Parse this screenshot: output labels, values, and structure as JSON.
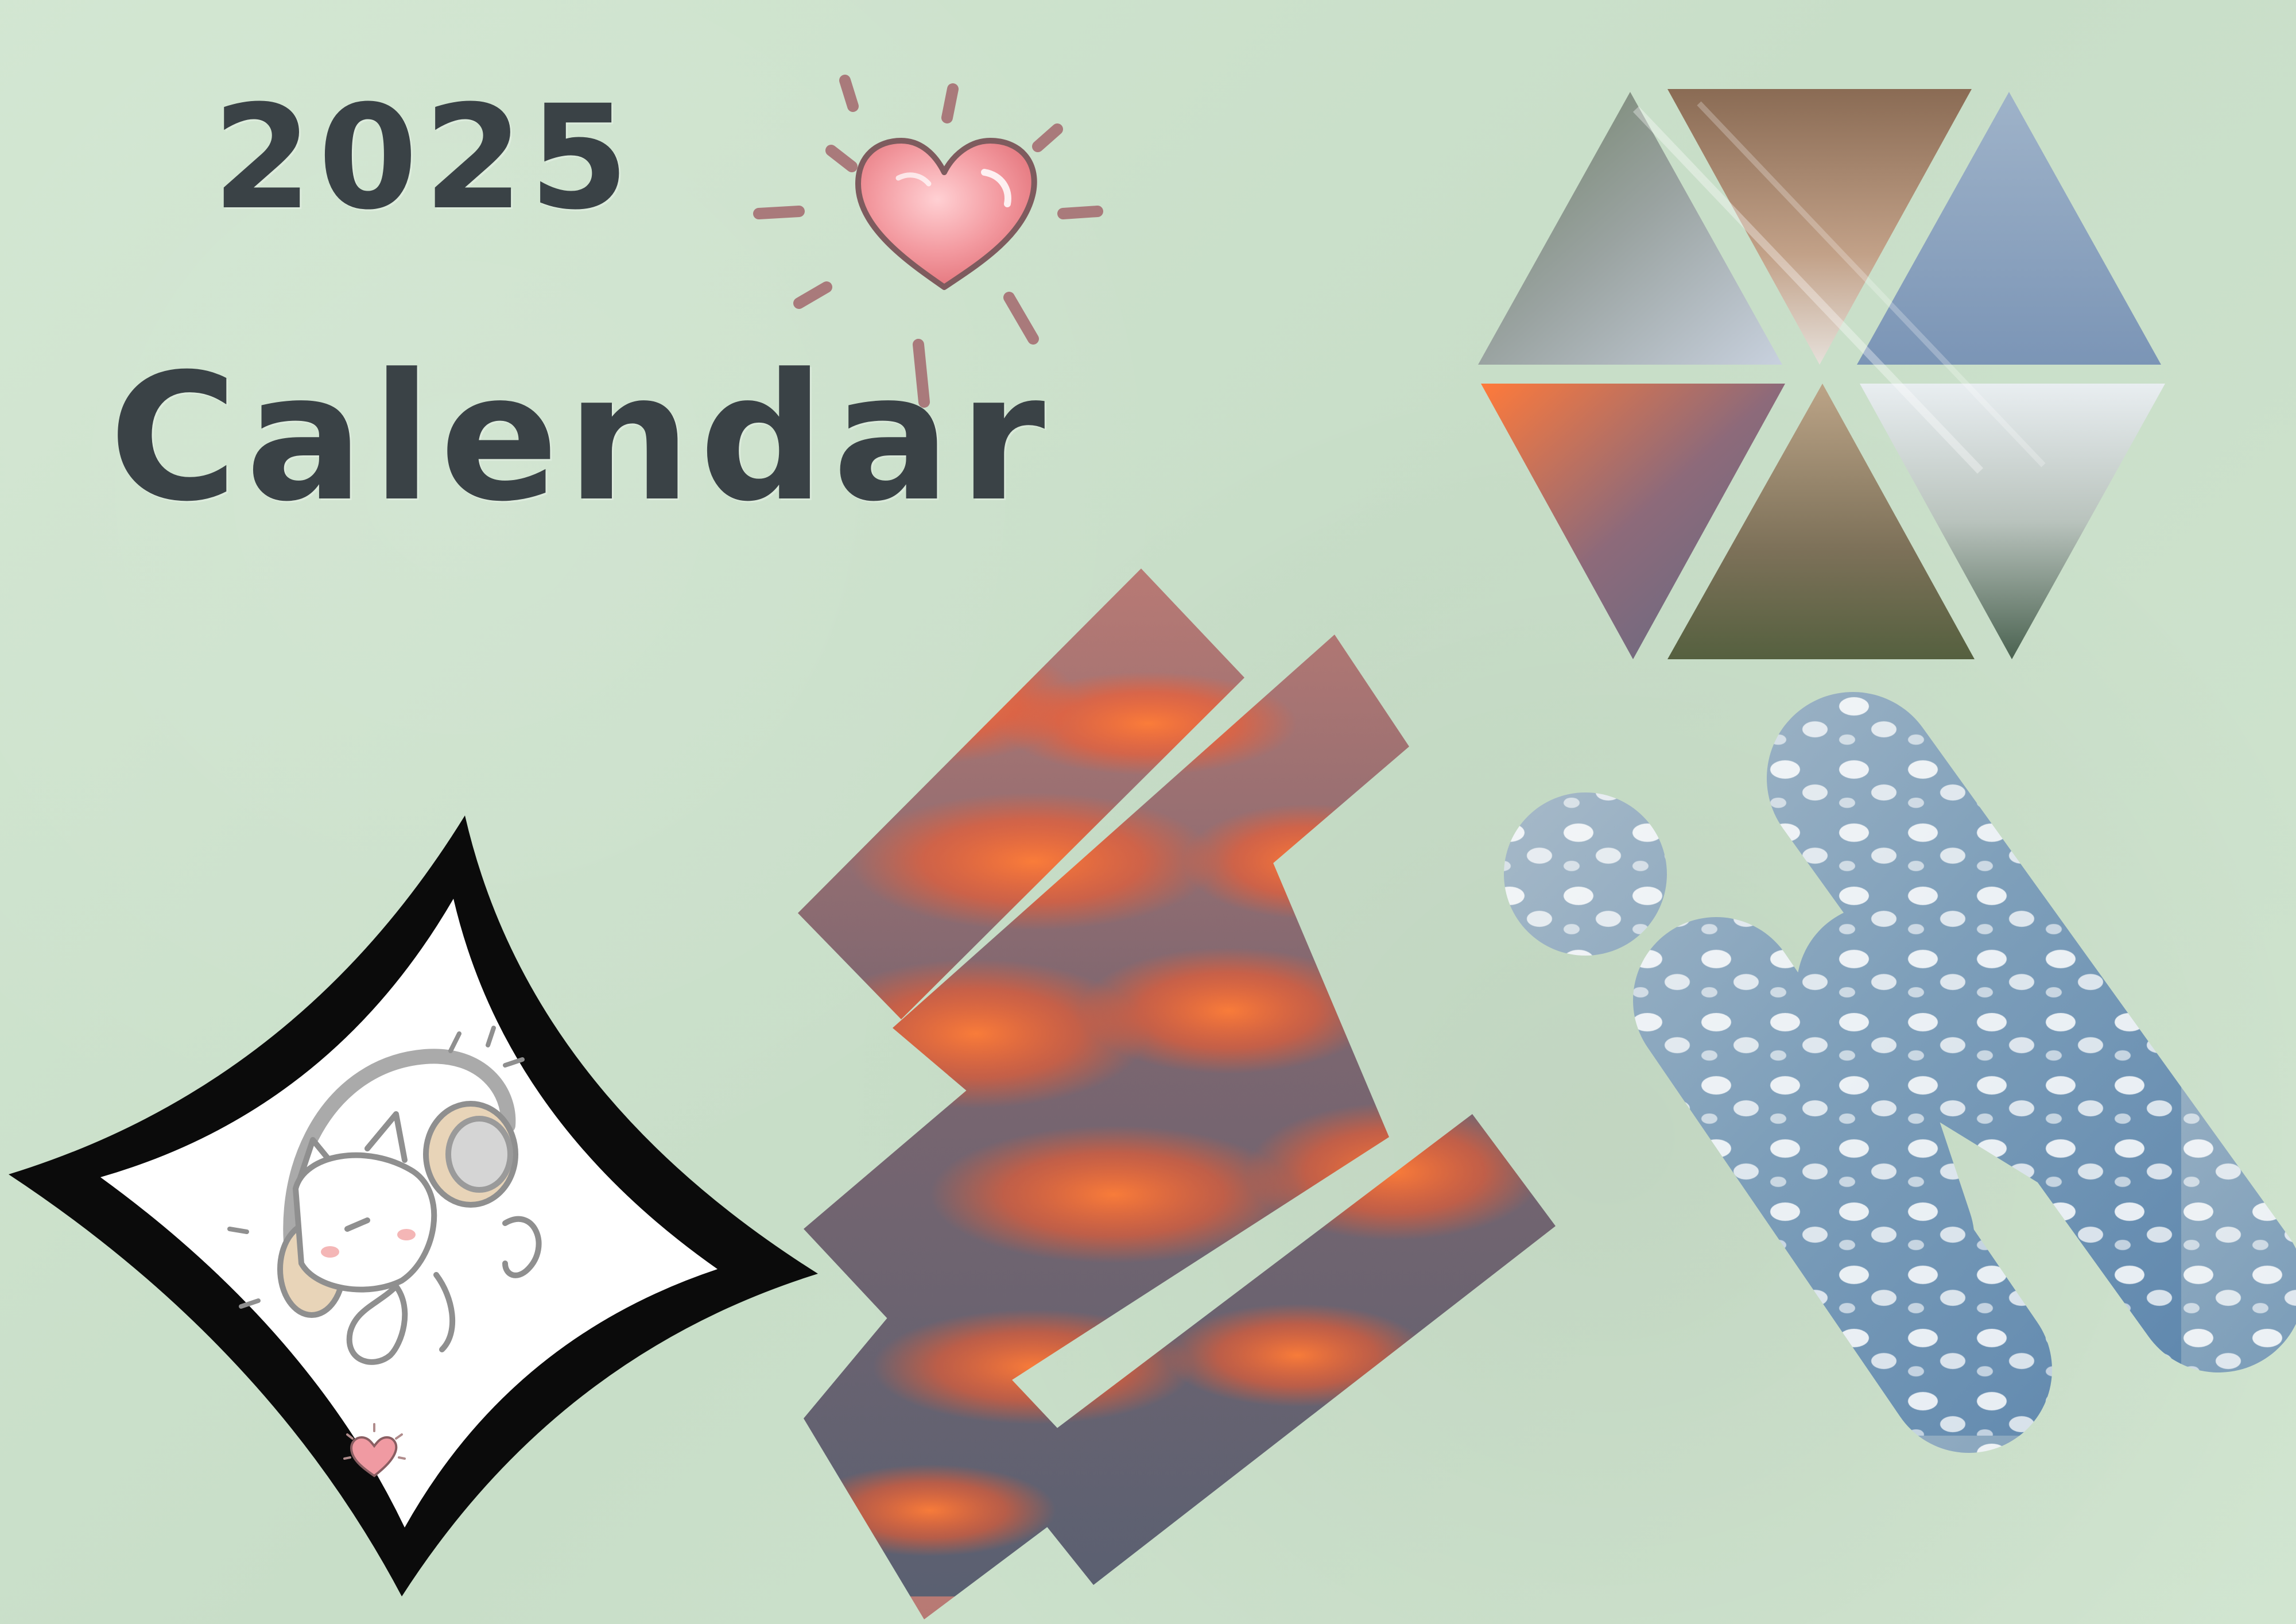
{
  "title": {
    "year": "2025",
    "word": "Calendar"
  },
  "decor": {
    "heart_sun": "heart-icon",
    "cat_sticker": "cat-with-headphones",
    "small_heart": "heart-icon"
  },
  "colors": {
    "background": "#cfe3cf",
    "text": "#3a4246",
    "heart": "#f38f97",
    "rays": "#a8787a",
    "frame": "#0b0b0b",
    "sunset_orange": "#ff6a2a",
    "sky_blue": "#7fa7c7"
  }
}
